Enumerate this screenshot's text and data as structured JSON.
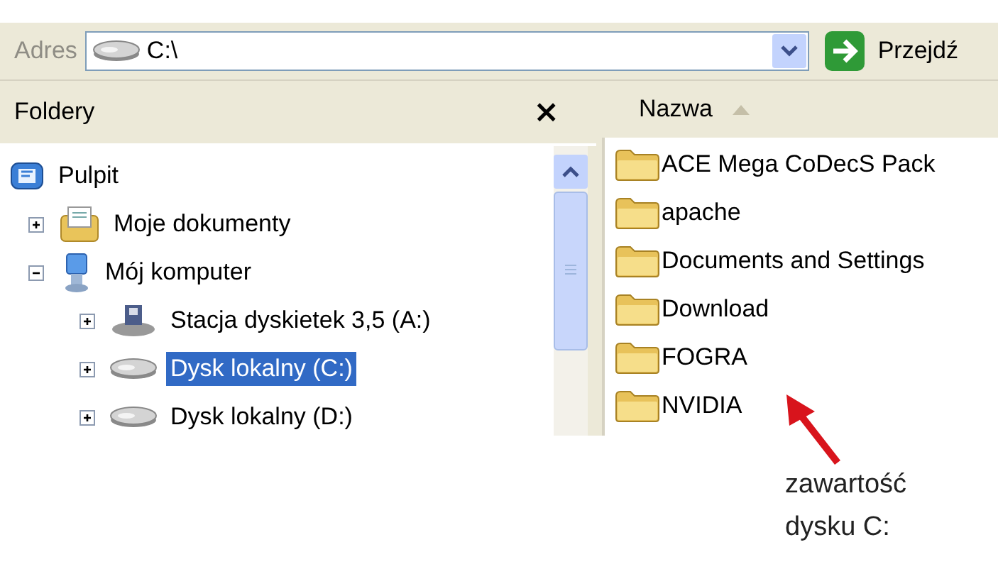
{
  "address_bar": {
    "label": "Adres",
    "value": "C:\\",
    "go_button": "Przejdź"
  },
  "folders_pane": {
    "title": "Foldery",
    "close": "×",
    "tree": [
      {
        "label": "Pulpit",
        "kind": "desktop",
        "selected": false,
        "children": [
          {
            "label": "Moje dokumenty",
            "kind": "documents",
            "expanded": false,
            "selected": false
          },
          {
            "label": "Mój komputer",
            "kind": "computer",
            "expanded": true,
            "selected": false,
            "children": [
              {
                "label": "Stacja dyskietek 3,5 (A:)",
                "kind": "floppy",
                "expanded": false,
                "selected": false
              },
              {
                "label": "Dysk lokalny (C:)",
                "kind": "drive",
                "expanded": false,
                "selected": true
              },
              {
                "label": "Dysk lokalny (D:)",
                "kind": "drive",
                "expanded": false,
                "selected": false
              }
            ]
          }
        ]
      }
    ]
  },
  "file_list": {
    "column": "Nazwa",
    "items": [
      {
        "name": "ACE Mega CoDecS Pack"
      },
      {
        "name": "apache"
      },
      {
        "name": "Documents and Settings"
      },
      {
        "name": "Download"
      },
      {
        "name": "FOGRA"
      },
      {
        "name": "NVIDIA"
      }
    ]
  },
  "annotation": {
    "text": "zawartość dysku C:"
  }
}
